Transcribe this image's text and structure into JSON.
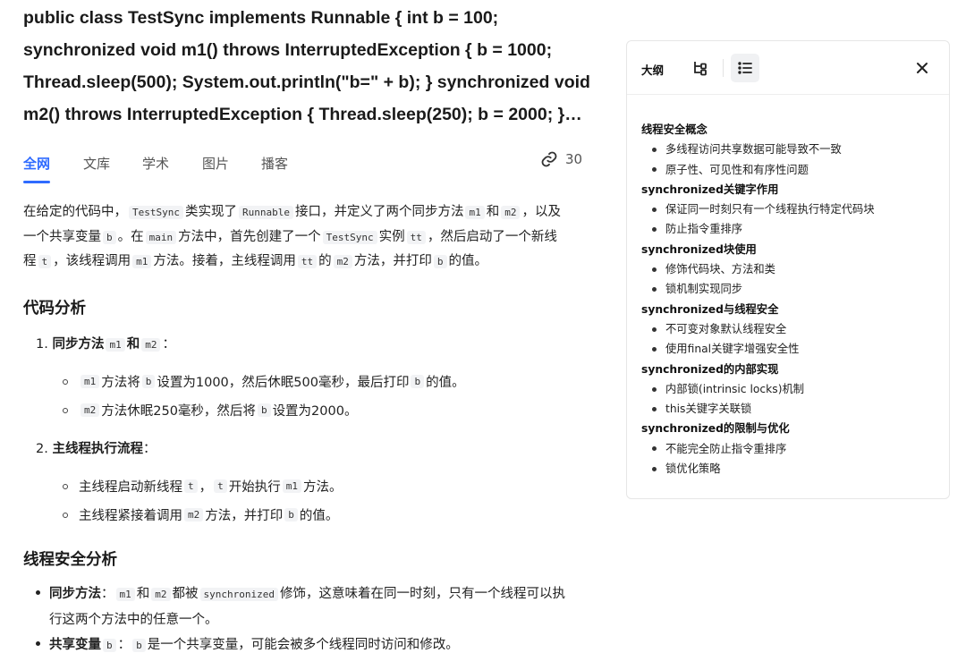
{
  "question": {
    "lines": [
      "public class TestSync implements Runnable { int b = 100;",
      "synchronized void m1() throws InterruptedException { b = 1000;",
      "Thread.sleep(500); System.out.println(\"b=\" + b); } synchronized void",
      "m2() throws InterruptedException { Thread.sleep(250); b = 2000; }…"
    ]
  },
  "tabs": [
    "全网",
    "文库",
    "学术",
    "图片",
    "播客"
  ],
  "link_count": "30",
  "intro": {
    "t1": "在给定的代码中，",
    "c1": "TestSync",
    "t2": "类实现了",
    "c2": "Runnable",
    "t3": "接口，并定义了两个同步方法",
    "c3": "m1",
    "t4": "和",
    "c4": "m2",
    "t5": "，以及",
    "t6": "一个共享变量",
    "c5": "b",
    "t7": "。在",
    "c6": "main",
    "t8": "方法中，首先创建了一个",
    "c7": "TestSync",
    "t9": "实例",
    "c8": "tt",
    "t10": "，然后启动了一个新线",
    "t11": "程",
    "c9": "t",
    "t12": "，该线程调用",
    "c10": "m1",
    "t13": "方法。接着，主线程调用",
    "c11": "tt",
    "t14": "的",
    "c12": "m2",
    "t15": "方法，并打印",
    "c13": "b",
    "t16": "的值。"
  },
  "section1": {
    "title": "代码分析",
    "item1": {
      "num": "1.",
      "bold": "同步方法",
      "c1": "m1",
      "and": "和",
      "c2": "m2",
      "colon": "："
    },
    "sub1": {
      "c1": "m1",
      "t1": "方法将",
      "c2": "b",
      "t2": "设置为1000，然后休眠500毫秒，最后打印",
      "c3": "b",
      "t3": "的值。"
    },
    "sub2": {
      "c1": "m2",
      "t1": "方法休眠250毫秒，然后将",
      "c2": "b",
      "t2": "设置为2000。"
    },
    "item2": {
      "num": "2.",
      "bold": "主线程执行流程",
      "colon": "："
    },
    "sub3": {
      "t1": "主线程启动新线程",
      "c1": "t",
      "t2": "，",
      "c2": "t",
      "t3": "开始执行",
      "c3": "m1",
      "t4": "方法。"
    },
    "sub4": {
      "t1": "主线程紧接着调用",
      "c1": "m2",
      "t2": "方法，并打印",
      "c2": "b",
      "t3": "的值。"
    }
  },
  "section2": {
    "title": "线程安全分析",
    "b1": {
      "bold": "同步方法",
      "colon": "：",
      "c1": "m1",
      "t1": "和",
      "c2": "m2",
      "t2": "都被",
      "c3": "synchronized",
      "t3": "修饰，这意味着在同一时刻，只有一个线程可以执",
      "t4": "行这两个方法中的任意一个。"
    },
    "b2": {
      "bold": "共享变量",
      "c1": "b",
      "colon": "：",
      "c2": "b",
      "t1": "是一个共享变量，可能会被多个线程同时访问和修改。"
    }
  },
  "outline_panel": {
    "title": "大纲",
    "sections": [
      {
        "title": "线程安全概念",
        "points": [
          "多线程访问共享数据可能导致不一致",
          "原子性、可见性和有序性问题"
        ]
      },
      {
        "title": "synchronized关键字作用",
        "points": [
          "保证同一时刻只有一个线程执行特定代码块",
          "防止指令重排序"
        ]
      },
      {
        "title": "synchronized块使用",
        "points": [
          "修饰代码块、方法和类",
          "锁机制实现同步"
        ]
      },
      {
        "title": "synchronized与线程安全",
        "points": [
          "不可变对象默认线程安全",
          "使用final关键字增强安全性"
        ]
      },
      {
        "title": "synchronized的内部实现",
        "points": [
          "内部锁(intrinsic locks)机制",
          "this关键字关联锁"
        ]
      },
      {
        "title": "synchronized的限制与优化",
        "points": [
          "不能完全防止指令重排序",
          "锁优化策略"
        ]
      }
    ]
  },
  "colors": {
    "accent": "#2f6bff",
    "code_bg": "#f2f3f5"
  },
  "icons": {
    "link": "link-icon",
    "mindmap": "mindmap-icon",
    "list": "list-icon",
    "close": "close-icon"
  }
}
